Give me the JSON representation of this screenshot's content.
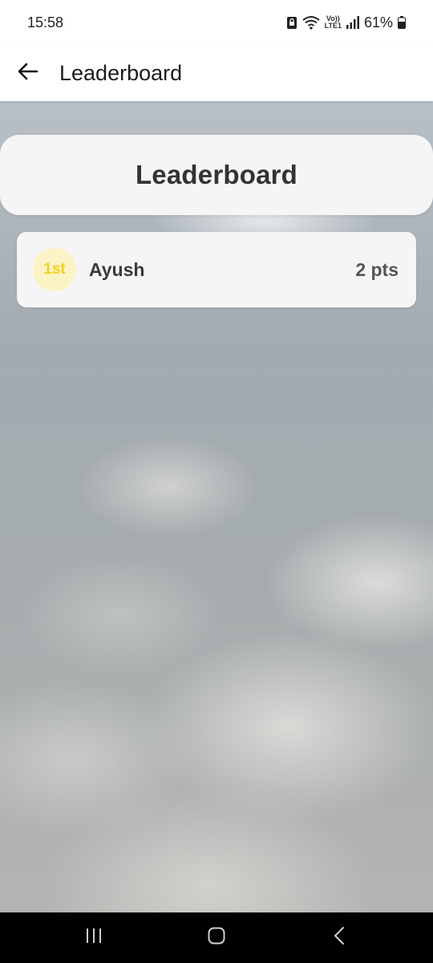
{
  "status_bar": {
    "time": "15:58",
    "network_top": "Vo))",
    "network_bottom": "LTE1",
    "battery": "61%",
    "icons": [
      "sim-lock-icon",
      "wifi-icon",
      "signal-icon",
      "battery-icon"
    ]
  },
  "app_bar": {
    "title": "Leaderboard",
    "back_icon": "arrow-left-icon"
  },
  "header": {
    "title": "Leaderboard"
  },
  "entries": [
    {
      "rank": "1st",
      "name": "Ayush",
      "points": "2 pts"
    }
  ],
  "nav_bar": {
    "icons": [
      "recent-apps-icon",
      "home-icon",
      "back-icon"
    ]
  },
  "colors": {
    "card_bg": "#f5f5f6",
    "rank_badge_bg": "#fbf3c6",
    "rank_text": "#f2d11a",
    "title_text": "#333333"
  }
}
